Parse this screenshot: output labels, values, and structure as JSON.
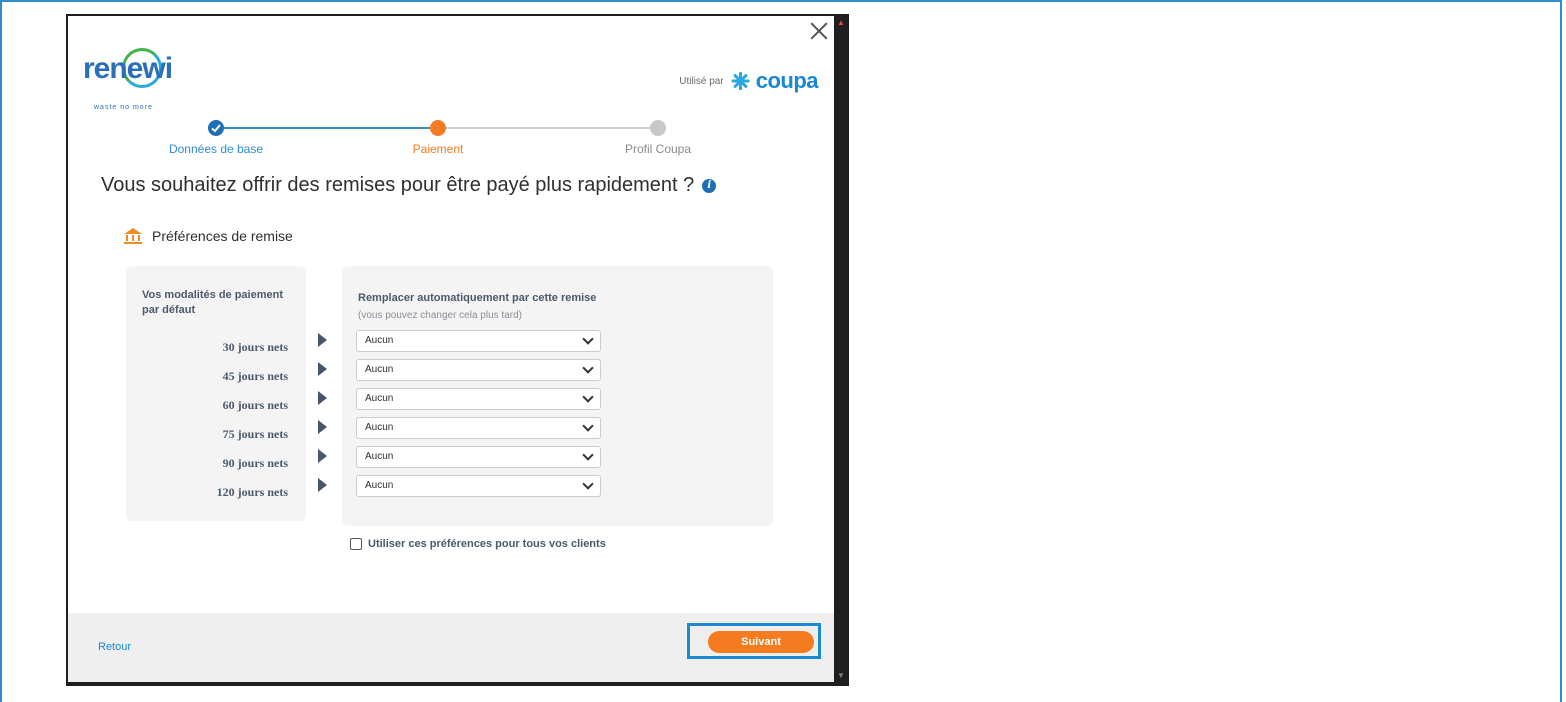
{
  "logo": {
    "word": "renewi",
    "tagline": "waste no more"
  },
  "powered_by": {
    "label": "Utilisé par",
    "brand": "coupa"
  },
  "stepper": {
    "steps": [
      {
        "label": "Données de base",
        "state": "done"
      },
      {
        "label": "Paiement",
        "state": "current"
      },
      {
        "label": "Profil Coupa",
        "state": "pending"
      }
    ],
    "colors": {
      "done": "#1f6fb6",
      "current": "#f47b20",
      "pending": "#c8c8c8",
      "line_done": "#2e8ccf",
      "line_pending": "#d0d0d0"
    }
  },
  "heading": "Vous souhaitez offrir des remises pour être payé plus rapidement ?",
  "section_title": "Préférences de remise",
  "left_panel": {
    "title": "Vos modalités de paiement par défaut",
    "terms": [
      "30 jours nets",
      "45 jours nets",
      "60 jours nets",
      "75 jours nets",
      "90 jours nets",
      "120 jours nets"
    ]
  },
  "right_panel": {
    "title": "Remplacer automatiquement par cette remise",
    "subtitle": "(vous pouvez changer cela plus tard)",
    "selects": [
      "Aucun",
      "Aucun",
      "Aucun",
      "Aucun",
      "Aucun",
      "Aucun"
    ]
  },
  "checkbox_label": "Utiliser ces préférences pour tous vos clients",
  "footer": {
    "back": "Retour",
    "next": "Suivant"
  }
}
